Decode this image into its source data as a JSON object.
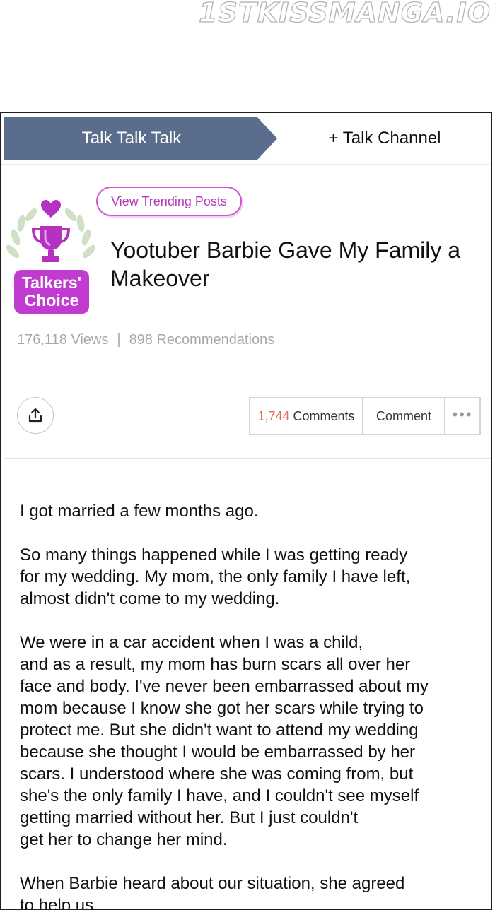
{
  "watermark": "1STKISSMANGA.IO",
  "tabs": {
    "active": "Talk Talk Talk",
    "channel": "+ Talk Channel"
  },
  "trending_button": "View Trending Posts",
  "badge": {
    "line1": "Talkers'",
    "line2": "Choice",
    "icon": "trophy-icon",
    "accent": "#c23bd0"
  },
  "post": {
    "title": "Yootuber Barbie Gave My Family a Makeover",
    "views": "176,118 Views",
    "separator": "|",
    "recommendations": "898 Recommendations"
  },
  "actions": {
    "comments_count": "1,744",
    "comments_label": "Comments",
    "comment_button": "Comment",
    "more": "•••"
  },
  "body": {
    "p1": "I got married a few months ago.",
    "p2": "So many things happened while I was getting ready\nfor my wedding. My mom, the only family I have left,\nalmost didn't come to my wedding.",
    "p3": "We were in a car accident when I was a child,\nand as a result, my mom has burn scars all over her\nface and body. I've never been embarrassed about my\nmom because I know she got her scars while trying to\nprotect me. But she didn't want to attend my wedding\nbecause she thought I would be embarrassed by her\nscars. I understood where she was coming from, but\nshe's the only family I have, and I couldn't see myself\ngetting married without her. But I just couldn't\nget her to change her mind.",
    "p4": "When Barbie heard about our situation, she agreed\nto help us."
  },
  "colors": {
    "tab_active_bg": "#5a6d8c",
    "trending_border": "#cf52d3",
    "comment_count": "#e4675f"
  }
}
